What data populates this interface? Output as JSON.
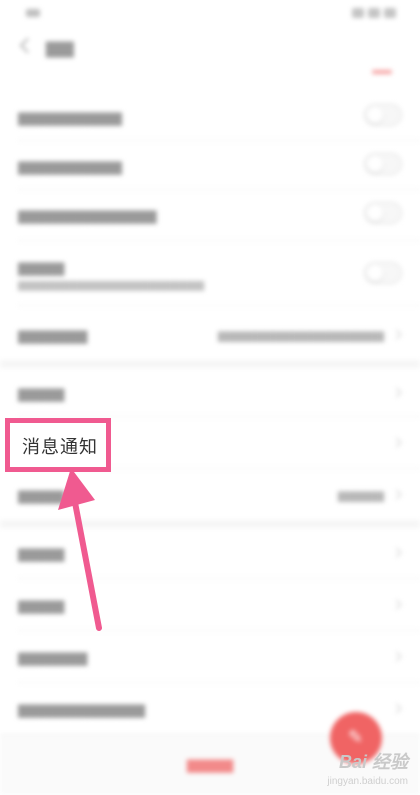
{
  "highlight": {
    "label": "消息通知"
  },
  "watermark": {
    "brand": "Bai 经验",
    "url": "jingyan.baidu.com"
  },
  "colors": {
    "annotation_pink": "#f05a90",
    "accent_red": "#f06464"
  },
  "icons": {
    "fab": "edit-icon",
    "back": "back-arrow-icon",
    "arrow": "annotation-arrow-icon"
  }
}
